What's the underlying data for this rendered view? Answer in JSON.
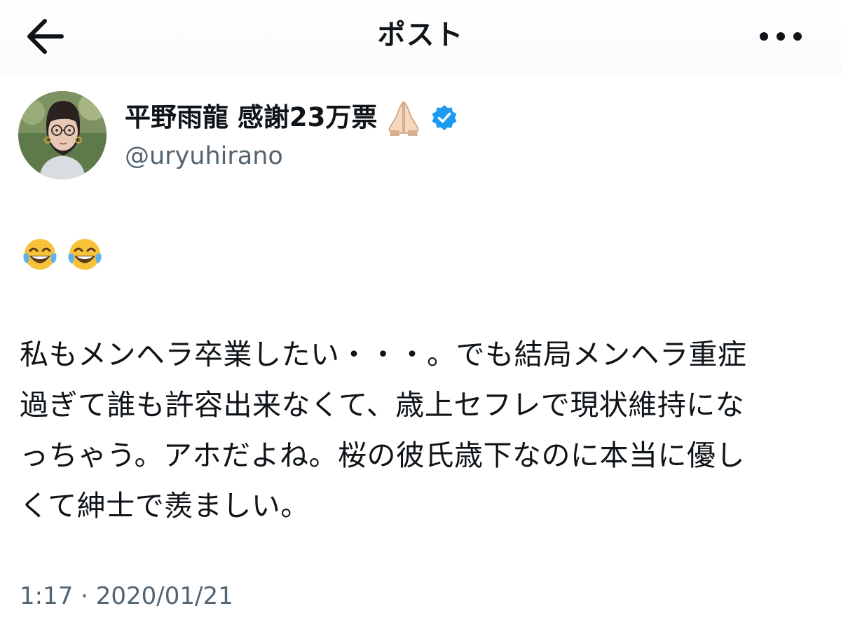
{
  "header": {
    "title": "ポスト",
    "back_icon": "arrow-left-icon",
    "more_icon": "more-horizontal-icon"
  },
  "author": {
    "display_name": "平野雨龍 感謝23万票",
    "name_emoji": "folded-hands-icon",
    "verified_icon": "verified-badge-icon",
    "verified_color": "#1d9bf0",
    "handle": "@uryuhirano"
  },
  "post": {
    "emojis": [
      "face-with-tears-of-joy-icon",
      "face-with-tears-of-joy-icon"
    ],
    "text": "私もメンヘラ卒業したい・・・。でも結局メンヘラ重症\n過ぎて誰も許容出来なくて、歳上セフレで現状維持にな\nっちゃう。アホだよね。桜の彼氏歳下なのに本当に優し\nくて紳士で羨ましい。",
    "timestamp": "1:17 · 2020/01/21"
  },
  "colors": {
    "text_primary": "#0f1419",
    "text_secondary": "#536471",
    "background": "#ffffff"
  }
}
